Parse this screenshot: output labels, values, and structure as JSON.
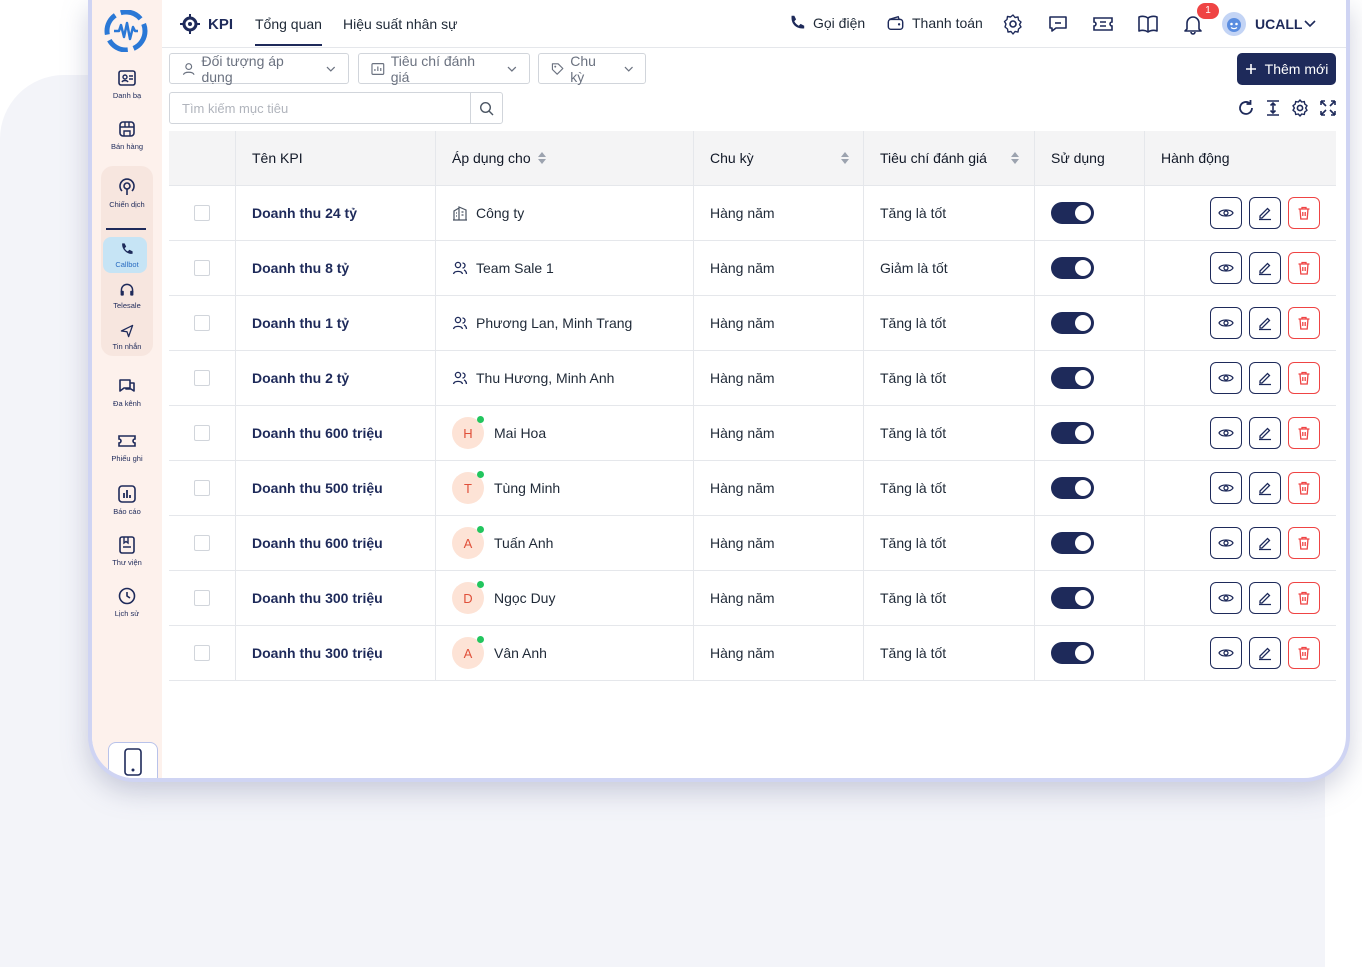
{
  "header": {
    "module_title": "KPI",
    "tabs": [
      {
        "label": "Tổng quan"
      },
      {
        "label": "Hiệu suất nhân sự"
      }
    ],
    "call_label": "Gọi điện",
    "payment_label": "Thanh toán",
    "notification_count": "1",
    "account_name": "UCALL"
  },
  "sidebar": {
    "items": [
      {
        "label": "Danh bạ",
        "icon": "contacts-icon"
      },
      {
        "label": "Bán hàng",
        "icon": "store-icon"
      },
      {
        "label": "Chiến dịch",
        "icon": "campaign-icon"
      },
      {
        "label": "Callbot",
        "icon": "callbot-icon"
      },
      {
        "label": "Telesale",
        "icon": "headset-icon"
      },
      {
        "label": "Tin nhắn",
        "icon": "send-icon"
      },
      {
        "label": "Đa kênh",
        "icon": "chat-icon"
      },
      {
        "label": "Phiếu ghi",
        "icon": "ticket-icon"
      },
      {
        "label": "Báo cáo",
        "icon": "report-icon"
      },
      {
        "label": "Thư viện",
        "icon": "library-icon"
      },
      {
        "label": "Lịch sử",
        "icon": "clock-icon"
      }
    ]
  },
  "filters": {
    "target": "Đối tượng áp dụng",
    "criteria": "Tiêu chí đánh giá",
    "cycle": "Chu kỳ",
    "add_button": "Thêm mới",
    "search_placeholder": "Tìm kiếm mục tiêu"
  },
  "table": {
    "columns": {
      "name": "Tên KPI",
      "apply": "Áp dụng cho",
      "cycle": "Chu kỳ",
      "criteria": "Tiêu chí đánh giá",
      "use": "Sử dụng",
      "action": "Hành động"
    },
    "rows": [
      {
        "name": "Doanh thu 24 tỷ",
        "apply_type": "company",
        "apply": "Công ty",
        "cycle": "Hàng năm",
        "criteria": "Tăng là tốt",
        "enabled": true
      },
      {
        "name": "Doanh thu 8 tỷ",
        "apply_type": "group",
        "apply": "Team Sale 1",
        "cycle": "Hàng năm",
        "criteria": "Giảm là tốt",
        "enabled": true
      },
      {
        "name": "Doanh thu 1 tỷ",
        "apply_type": "group",
        "apply": "Phương Lan, Minh Trang",
        "cycle": "Hàng năm",
        "criteria": "Tăng là tốt",
        "enabled": true
      },
      {
        "name": "Doanh thu 2 tỷ",
        "apply_type": "group",
        "apply": "Thu Hương, Minh Anh",
        "cycle": "Hàng năm",
        "criteria": "Tăng là tốt",
        "enabled": true
      },
      {
        "name": "Doanh thu 600 triệu",
        "apply_type": "person",
        "initial": "H",
        "apply": "Mai Hoa",
        "cycle": "Hàng năm",
        "criteria": "Tăng là tốt",
        "enabled": true
      },
      {
        "name": "Doanh thu 500 triệu",
        "apply_type": "person",
        "initial": "T",
        "apply": "Tùng Minh",
        "cycle": "Hàng năm",
        "criteria": "Tăng là tốt",
        "enabled": true
      },
      {
        "name": "Doanh thu 600 triệu",
        "apply_type": "person",
        "initial": "A",
        "apply": "Tuấn Anh",
        "cycle": "Hàng năm",
        "criteria": "Tăng là tốt",
        "enabled": true
      },
      {
        "name": "Doanh thu 300 triệu",
        "apply_type": "person",
        "initial": "D",
        "apply": "Ngọc Duy",
        "cycle": "Hàng năm",
        "criteria": "Tăng là tốt",
        "enabled": true
      },
      {
        "name": "Doanh thu 300 triệu",
        "apply_type": "person",
        "initial": "A",
        "apply": "Vân Anh",
        "cycle": "Hàng năm",
        "criteria": "Tăng là tốt",
        "enabled": true
      }
    ]
  },
  "colors": {
    "brand": "#1e2a5a",
    "danger": "#ef4444",
    "sidebar_bg": "#fdf1ec",
    "online": "#22c55e"
  }
}
